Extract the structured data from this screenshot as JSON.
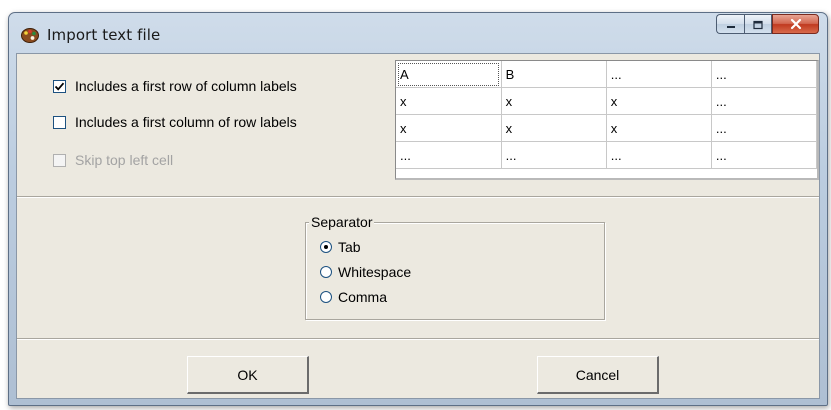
{
  "window": {
    "title": "Import text file",
    "icon": "paint-palette-icon"
  },
  "caption_buttons": {
    "minimize": "minimize-icon",
    "maximize": "maximize-icon",
    "close": "close-icon"
  },
  "options": {
    "column_labels": {
      "label": "Includes a first row of column labels",
      "checked": true,
      "enabled": true
    },
    "row_labels": {
      "label": "Includes a first column of row labels",
      "checked": false,
      "enabled": true
    },
    "skip_cell": {
      "label": "Skip top left cell",
      "checked": false,
      "enabled": false
    }
  },
  "preview": {
    "rows": [
      [
        "A",
        "B",
        "...",
        "..."
      ],
      [
        "x",
        "x",
        "x",
        "..."
      ],
      [
        "x",
        "x",
        "x",
        "..."
      ],
      [
        "...",
        "...",
        "...",
        "..."
      ]
    ]
  },
  "separator": {
    "legend": "Separator",
    "options": [
      "Tab",
      "Whitespace",
      "Comma"
    ],
    "selected": "Tab"
  },
  "buttons": {
    "ok": "OK",
    "cancel": "Cancel"
  }
}
